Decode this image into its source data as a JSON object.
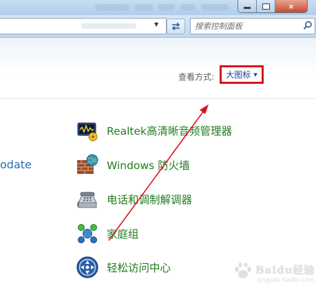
{
  "toolbar": {
    "search_placeholder": "搜索控制面板",
    "window_controls": {
      "minimize": "minimize",
      "maximize": "maximize",
      "close": "×"
    }
  },
  "view": {
    "label": "查看方式:",
    "selected": "大图标"
  },
  "partial_item": "odate",
  "items": [
    {
      "label": "Realtek高清晰音频管理器",
      "icon": "audio-manager-icon"
    },
    {
      "label": "Windows 防火墙",
      "icon": "firewall-icon"
    },
    {
      "label": "电话和调制解调器",
      "icon": "phone-modem-icon"
    },
    {
      "label": "家庭组",
      "icon": "homegroup-icon"
    },
    {
      "label": "轻松访问中心",
      "icon": "ease-of-access-icon"
    }
  ],
  "annotation": {
    "color": "#d8121f"
  },
  "watermark": {
    "text": "Baidu经验",
    "url": "jingyan.baidu.com"
  }
}
